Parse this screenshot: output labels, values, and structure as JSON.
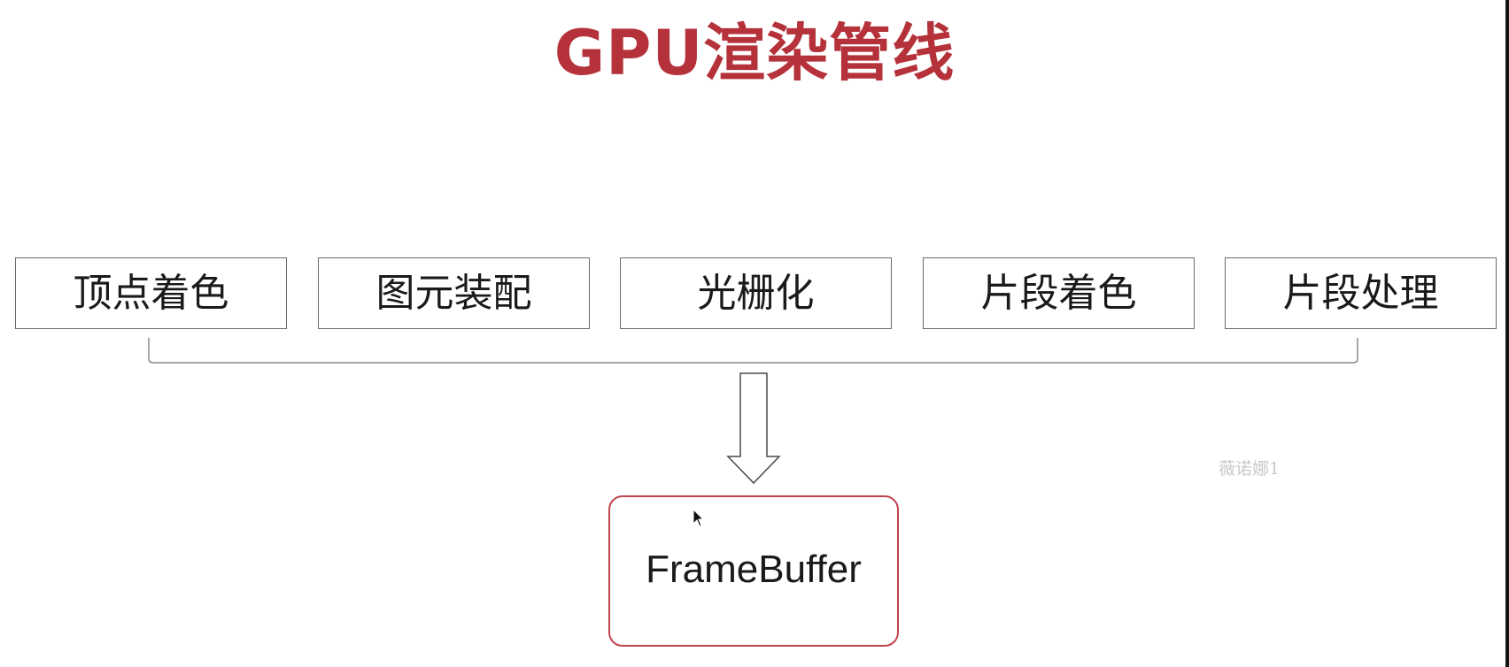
{
  "title": "GPU渲染管线",
  "stages": [
    {
      "label": "顶点着色"
    },
    {
      "label": "图元装配"
    },
    {
      "label": "光栅化"
    },
    {
      "label": "片段着色"
    },
    {
      "label": "片段处理"
    }
  ],
  "output": {
    "label": "FrameBuffer"
  },
  "watermark": "薇诺娜1",
  "colors": {
    "title": "#b5323b",
    "output_border": "#c0444f",
    "stage_border": "#6b6b6b",
    "connector": "#8a8a8a"
  }
}
